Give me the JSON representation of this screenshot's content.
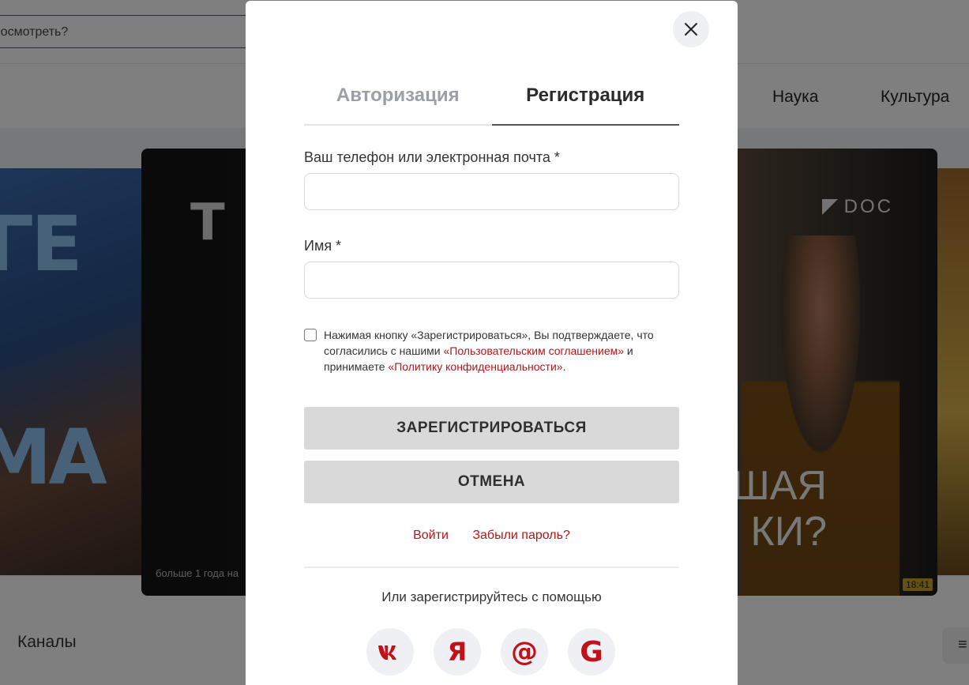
{
  "background": {
    "search": {
      "placeholder_fragment": "посмотреть?"
    },
    "nav": [
      "Наука",
      "Культура"
    ],
    "card": {
      "brand_left": "T",
      "brand_right": "DOC",
      "title_fragment": "ШАЯ\nКИ?",
      "subtitle_fragment": "больше 1 года на",
      "duration": "18:41"
    },
    "channels_label": "Каналы",
    "menu_icon": "≡"
  },
  "modal": {
    "tabs": {
      "login": "Авторизация",
      "register": "Регистрация"
    },
    "contact_label": "Ваш телефон или электронная почта *",
    "contact_value": "",
    "name_label": "Имя *",
    "name_value": "",
    "agree": {
      "text_before": "Нажимая кнопку «Зарегистрироваться», Вы подтверждаете, что согласились с нашими ",
      "agreement_link": "«Пользовательским соглашением»",
      "text_middle": " и принимаете ",
      "privacy_link": "«Политику конфиденциальности»",
      "text_after": ".",
      "checked": false
    },
    "register_button": "ЗАРЕГИСТРИРОВАТЬСЯ",
    "cancel_button": "ОТМЕНА",
    "login_link": "Войти",
    "forgot_link": "Забыли пароль?",
    "or_text": "Или зарегистрируйтесь с помощью",
    "social": [
      {
        "icon": "vk-icon",
        "glyph": "vk"
      },
      {
        "icon": "yandex-icon",
        "glyph": "Я"
      },
      {
        "icon": "mailru-icon",
        "glyph": "@"
      },
      {
        "icon": "google-icon",
        "glyph": "G"
      }
    ],
    "colors": {
      "accent": "#b1171a",
      "button_bg": "#d9d9d9",
      "overlay": "rgba(0,0,0,0.5)"
    }
  }
}
